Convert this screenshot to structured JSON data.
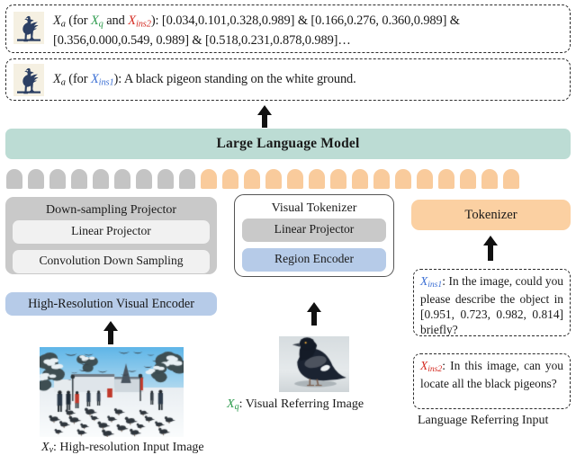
{
  "answers": [
    {
      "id": "answer-box-grounding",
      "icon": "vicuna-llama-icon",
      "line1_prefix": "Xa",
      "line1": "Xa (for Xq and Xins2): [0.034,0.101,0.328,0.989] & [0.166,0.276, 0.360,0.989] &",
      "line2": "[0.356,0.000,0.549, 0.989] & [0.518,0.231,0.878,0.989]…",
      "tokens": {
        "x_a": "X",
        "x_a_sub": "a",
        "for": "(for ",
        "x_q": "X",
        "x_q_sub": "q",
        "and": " and ",
        "x_ins2": "X",
        "x_ins2_sub": "ins2",
        "colon": "): ",
        "boxes_line1": "[0.034,0.101,0.328,0.989] & [0.166,0.276, 0.360,0.989] &",
        "boxes_line2": "[0.356,0.000,0.549, 0.989] & [0.518,0.231,0.878,0.989]…"
      }
    },
    {
      "id": "answer-box-caption",
      "icon": "vicuna-llama-icon",
      "tokens": {
        "x_a": "X",
        "x_a_sub": "a",
        "for": "(for ",
        "x_ins1": "X",
        "x_ins1_sub": "ins1",
        "colon": "): ",
        "text": "A black pigeon standing on the white ground."
      }
    }
  ],
  "llm": {
    "label": "Large Language Model"
  },
  "tokens_row": {
    "gray_count": 9,
    "orange_count": 15,
    "gray_color": "#c4c4c4",
    "orange_color": "#f9cb9c"
  },
  "modules": {
    "downsampling_projector": {
      "title": "Down-sampling Projector",
      "items": [
        "Linear Projector",
        "Convolution Down Sampling"
      ]
    },
    "visual_tokenizer": {
      "title": "Visual Tokenizer",
      "items": [
        "Linear Projector",
        "Region Encoder"
      ]
    },
    "visual_encoder": {
      "label": "High-Resolution Visual Encoder"
    },
    "tokenizer": {
      "label": "Tokenizer"
    }
  },
  "prompts": [
    {
      "id": "prompt-ins1",
      "marker": "X",
      "marker_sub": "ins1",
      "marker_color": "#3b6fd4",
      "text": ": In the image, could you please describe the object in [0.951, 0.723, 0.982, 0.814] briefly?"
    },
    {
      "id": "prompt-ins2",
      "marker": "X",
      "marker_sub": "ins2",
      "marker_color": "#d42a21",
      "text": ": In this image, can you locate all the black pigeons?"
    }
  ],
  "captions": {
    "input_image": {
      "marker": "X",
      "marker_sub": "v",
      "text": ": High-resolution Input Image"
    },
    "referring_image": {
      "marker": "X",
      "marker_sub": "q",
      "marker_color": "#2e9b4e",
      "text": ": Visual Referring Image"
    },
    "language_referring": "Language Referring Input"
  },
  "colors": {
    "llm_bar": "#bcdcd4",
    "panel_gray": "#c9c9c9",
    "blue_block": "#b6cbe8",
    "orange_block": "#fbd0a2",
    "green_text": "#2e9b4e",
    "red_text": "#d42a21",
    "blue_text": "#3b6fd4"
  }
}
